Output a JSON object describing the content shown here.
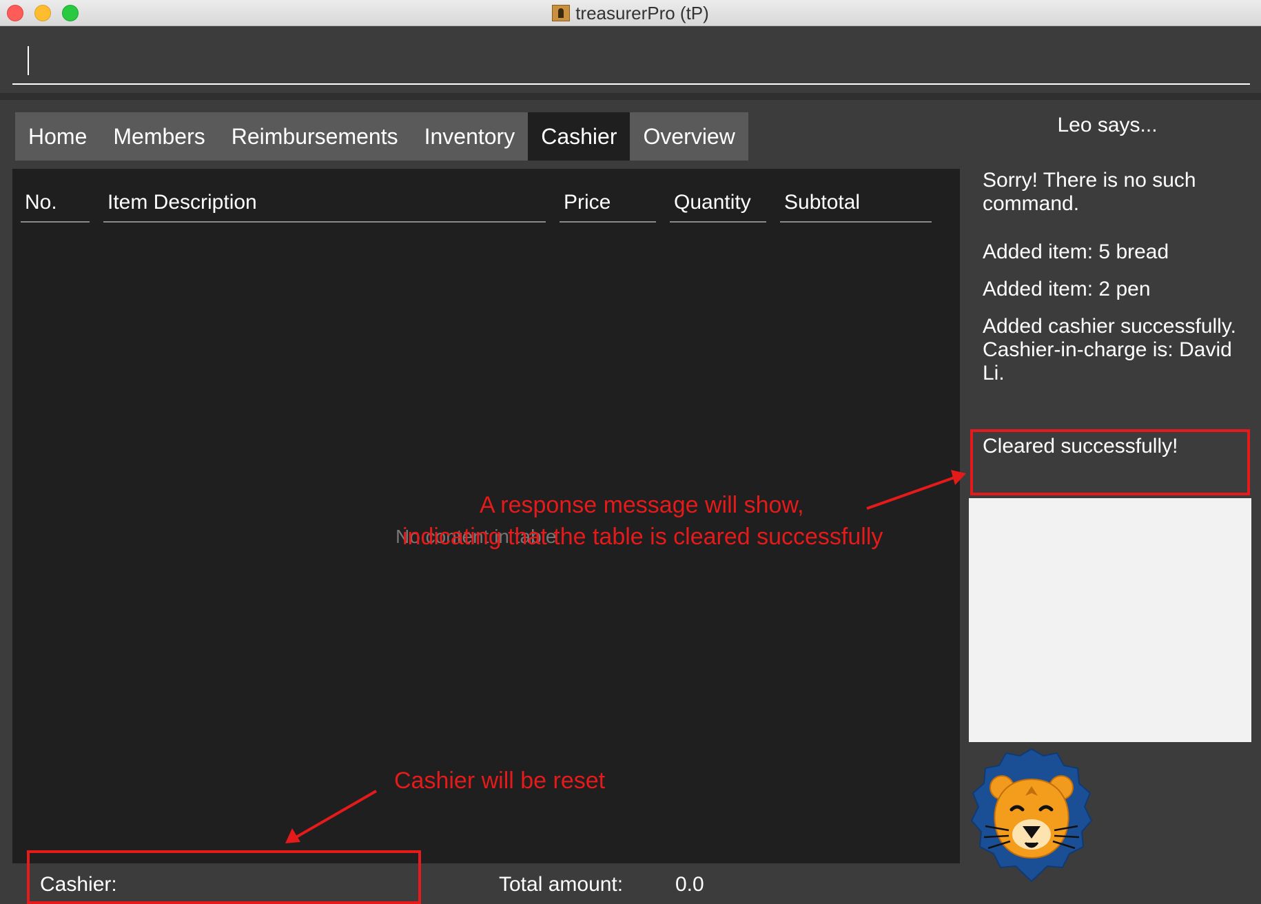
{
  "window": {
    "title": "treasurerPro (tP)"
  },
  "command": {
    "value": ""
  },
  "tabs": [
    {
      "label": "Home",
      "active": false
    },
    {
      "label": "Members",
      "active": false
    },
    {
      "label": "Reimbursements",
      "active": false
    },
    {
      "label": "Inventory",
      "active": false
    },
    {
      "label": "Cashier",
      "active": true
    },
    {
      "label": "Overview",
      "active": false
    }
  ],
  "table": {
    "columns": [
      "No.",
      "Item Description",
      "Price",
      "Quantity",
      "Subtotal"
    ],
    "placeholder": "No content in table",
    "rows": []
  },
  "footer": {
    "cashier_label": "Cashier:",
    "total_label": "Total amount:",
    "total_value": "0.0"
  },
  "leo": {
    "title": "Leo says...",
    "messages": [
      "Sorry! There is no such command.",
      "Added item: 5 bread",
      "Added item: 2 pen",
      "Added cashier successfully. Cashier-in-charge is: David Li.",
      "Cleared successfully!"
    ]
  },
  "annotations": {
    "response_line1": "A response message will show,",
    "response_line2": "indicating that the table is cleared successfully",
    "cashier_reset": "Cashier will be reset",
    "color": "#e51a1a"
  },
  "icons": {
    "app": "treasure-chest-icon",
    "mascot": "lion-mascot-icon"
  },
  "colors": {
    "background": "#3c3c3c",
    "table_bg": "#1f1f1f",
    "tab_bg": "#5a5a5a",
    "tab_active_bg": "#1f1f1f"
  }
}
